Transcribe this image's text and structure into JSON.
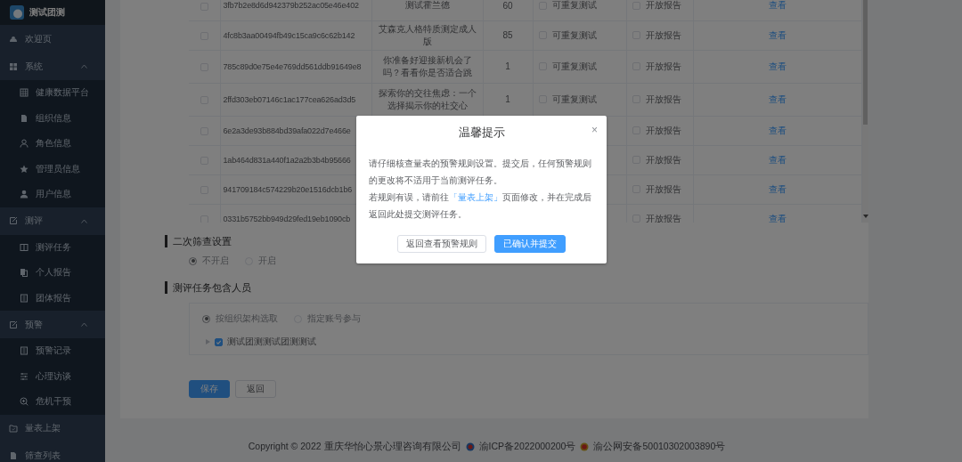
{
  "sidebar": {
    "logo_text": "测试团测",
    "menu": [
      {
        "kind": "item",
        "label": "欢迎页"
      },
      {
        "kind": "group",
        "label": "系统",
        "expanded": true,
        "children": [
          {
            "label": "健康数据平台"
          },
          {
            "label": "组织信息"
          },
          {
            "label": "角色信息"
          },
          {
            "label": "管理员信息"
          },
          {
            "label": "用户信息"
          }
        ]
      },
      {
        "kind": "group",
        "label": "测评",
        "expanded": true,
        "children": [
          {
            "label": "测评任务"
          },
          {
            "label": "个人报告"
          },
          {
            "label": "团体报告"
          }
        ]
      },
      {
        "kind": "group",
        "label": "预警",
        "expanded": true,
        "children": [
          {
            "label": "预警记录"
          },
          {
            "label": "心理访谈"
          },
          {
            "label": "危机干预"
          }
        ]
      },
      {
        "kind": "item",
        "label": "量表上架"
      },
      {
        "kind": "item",
        "label": "筛查列表"
      }
    ]
  },
  "table": {
    "rows": [
      {
        "checked": false,
        "id": "3fb7b2e8d6d942379b252ac05e46e402",
        "name": "测试霍兰德",
        "score": "60",
        "repeat": {
          "label": "可重复测试",
          "checked": false
        },
        "report": {
          "label": "开放报告",
          "checked": false
        },
        "action": "查看"
      },
      {
        "checked": false,
        "id": "4fc8b3aa00494fb49c15ca9c6c62b142",
        "name": "艾森克人格特质测定成人版",
        "score": "85",
        "repeat": {
          "label": "可重复测试",
          "checked": false
        },
        "report": {
          "label": "开放报告",
          "checked": false
        },
        "action": "查看"
      },
      {
        "checked": false,
        "id": "785c89d0e75e4e769dd561ddb91649e8",
        "name": "你准备好迎接新机会了吗？看看你是否适合跳",
        "score": "1",
        "repeat": {
          "label": "可重复测试",
          "checked": false
        },
        "report": {
          "label": "开放报告",
          "checked": false
        },
        "action": "查看"
      },
      {
        "checked": false,
        "id": "2ffd303eb07146c1ac177cea626ad3d5",
        "name": "探索你的交往焦虑：一个选择揭示你的社交心",
        "score": "1",
        "repeat": {
          "label": "可重复测试",
          "checked": false
        },
        "report": {
          "label": "开放报告",
          "checked": false
        },
        "action": "查看"
      },
      {
        "checked": false,
        "id": "6e2a3de93b884bd39afa022d7e466e",
        "report": {
          "label": "开放报告",
          "checked": false
        },
        "action": "查看"
      },
      {
        "checked": false,
        "id": "1ab464d831a440f1a2a2b3b4b95666",
        "report": {
          "label": "开放报告",
          "checked": false
        },
        "action": "查看"
      },
      {
        "checked": false,
        "id": "941709184c574229b20e1516dcb1b6",
        "report": {
          "label": "开放报告",
          "checked": false
        },
        "action": "查看"
      },
      {
        "checked": false,
        "id": "0331b5752bb949d29fed19eb1090cb",
        "report": {
          "label": "开放报告",
          "checked": false
        },
        "action": "查看"
      }
    ]
  },
  "screening": {
    "title": "二次筛查设置",
    "disabled": true,
    "options": [
      {
        "label": "不开启",
        "selected": true
      },
      {
        "label": "开启",
        "selected": false
      }
    ]
  },
  "members": {
    "title": "测评任务包含人员",
    "disabled": true,
    "options": [
      {
        "label": "按组织架构选取",
        "selected": true
      },
      {
        "label": "指定账号参与",
        "selected": false
      }
    ],
    "tree": [
      {
        "label": "测试团测测试团测测试",
        "checked": true,
        "expanded": false
      }
    ]
  },
  "buttons": [
    {
      "kind": "primary",
      "label": "保存"
    },
    {
      "kind": "default",
      "label": "返回"
    }
  ],
  "footer": {
    "copyright": "Copyright © 2022 重庆华怡心景心理咨询有限公司",
    "icp": "渝ICP备2022000200号",
    "police": "渝公网安备50010302003890号"
  },
  "dialog": {
    "title": "温馨提示",
    "close": "×",
    "paragraphs": [
      {
        "text": "请仔细核查量表的预警规则设置。提交后，任何预警规则的更改将不适用于当前测评任务。"
      },
      {
        "text": "若规则有误，请前往",
        "link": "「量表上架」",
        "after": "页面修改，并在完成后返回此处提交测评任务。"
      }
    ],
    "buttons": [
      {
        "kind": "default",
        "label": "返回查看预警规则"
      },
      {
        "kind": "primary",
        "label": "已确认并提交"
      }
    ]
  }
}
